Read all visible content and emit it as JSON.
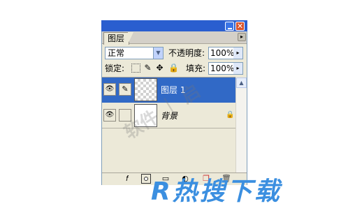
{
  "window": {
    "minimize_icon": "minimize-icon",
    "close_glyph": "✕"
  },
  "panel": {
    "tab_label": "图层",
    "menu_glyph": "▸"
  },
  "blend": {
    "value": "正常",
    "dropdown_glyph": "▼"
  },
  "opacity": {
    "label": "不透明度:",
    "value": "100%",
    "arrow_glyph": "▸"
  },
  "lock": {
    "label": "锁定:",
    "icons": [
      {
        "name": "lock-transparent-icon",
        "glyph": ""
      },
      {
        "name": "lock-pixels-icon",
        "glyph": "✎"
      },
      {
        "name": "lock-position-icon",
        "glyph": "✥"
      },
      {
        "name": "lock-all-icon",
        "glyph": "🔒"
      }
    ]
  },
  "fill": {
    "label": "填充:",
    "value": "100%",
    "arrow_glyph": "▸"
  },
  "layers": [
    {
      "name": "图层 1",
      "selected": true,
      "eye_glyph": "👁",
      "brush_glyph": "✎"
    },
    {
      "name": "背景",
      "selected": false,
      "eye_glyph": "👁",
      "lock_glyph": "🔒"
    }
  ],
  "scroll_up_glyph": "▲",
  "bottom_bar": {
    "style_glyph": "𝑓",
    "group_glyph": "▭",
    "adjust_glyph": "◐",
    "new_glyph": "❐",
    "trash_glyph": "🗑"
  },
  "watermarks": {
    "diagonal": "软件 ｜ 启",
    "site": "R热搜下载"
  },
  "colors": {
    "selected_row": "#3169c6",
    "titlebar": "#2a5ecf",
    "panel_bg": "#ece9d8"
  }
}
